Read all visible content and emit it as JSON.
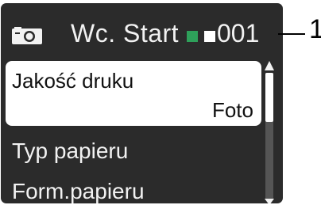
{
  "screen": {
    "title": "Wc. Start",
    "copy_count": "001",
    "callout_number": "1",
    "icons": [
      "camera-icon",
      "green-square-indicator",
      "white-square-indicator"
    ],
    "colors": {
      "lcd_background": "#2b2b2b",
      "indicator_green": "#2ea05a",
      "selected_background": "#ffffff"
    }
  },
  "menu": {
    "selected": {
      "label": "Jakość druku",
      "value": "Foto"
    },
    "items": [
      {
        "label": "Typ papieru"
      },
      {
        "label": "Form.papieru"
      }
    ]
  }
}
